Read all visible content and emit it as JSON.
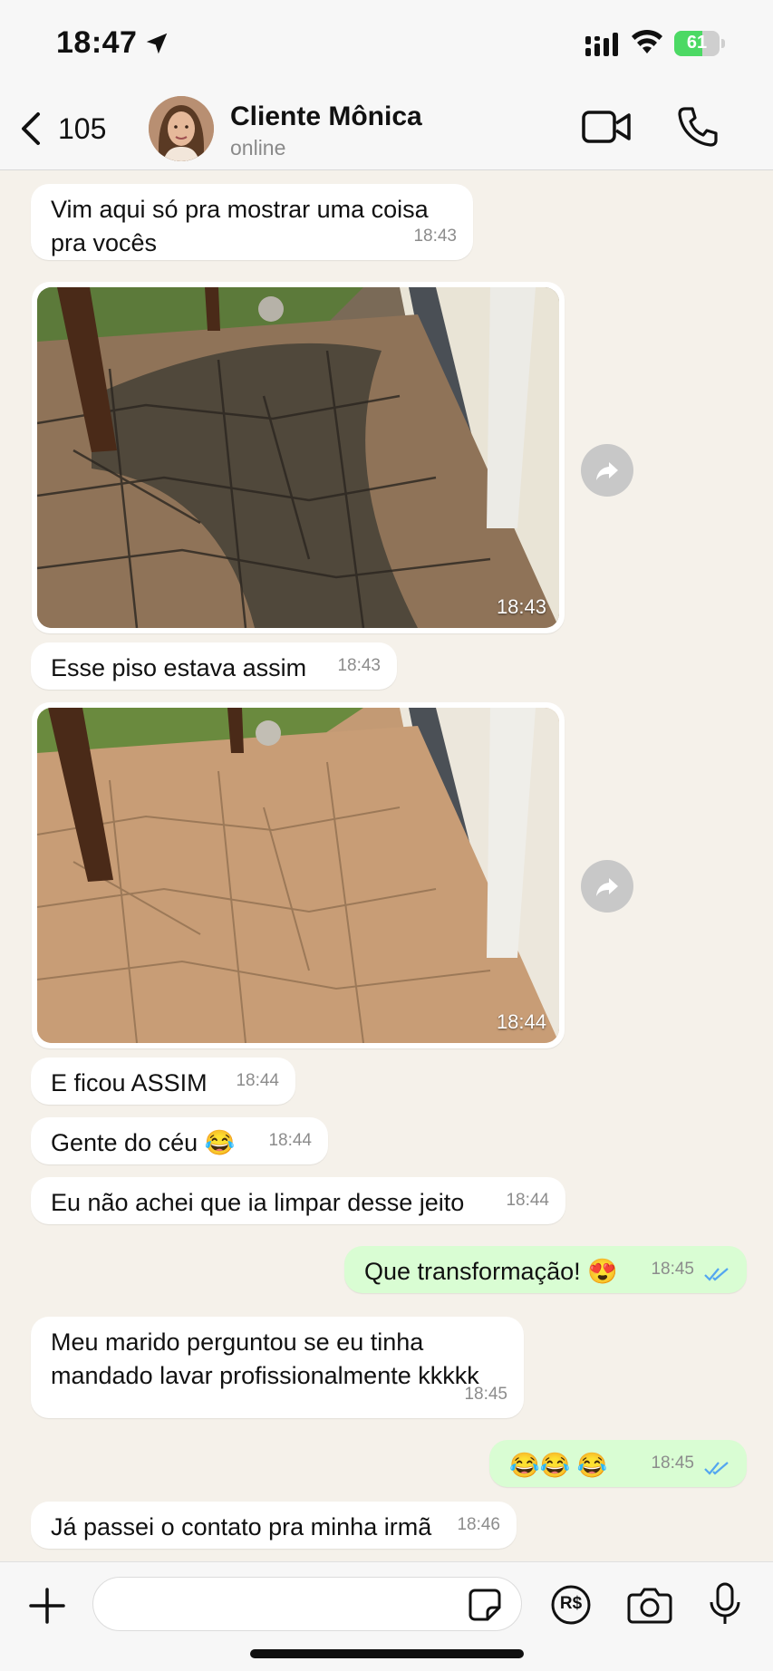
{
  "status_bar": {
    "time": "18:47",
    "battery": "61",
    "battery_level": 0.61
  },
  "header": {
    "back_count": "105",
    "contact_name": "Cliente Mônica",
    "contact_status": "online"
  },
  "messages": [
    {
      "type": "text",
      "direction": "in",
      "text_lines": [
        "Vim aqui só pra mostrar uma coisa",
        "pra vocês"
      ],
      "time": "18:43"
    },
    {
      "type": "image",
      "direction": "in",
      "alt": "Piso de pedra sujo antes da limpeza",
      "time": "18:43"
    },
    {
      "type": "text",
      "direction": "in",
      "text": "Esse piso estava assim",
      "time": "18:43"
    },
    {
      "type": "image",
      "direction": "in",
      "alt": "Piso de pedra limpo depois da limpeza",
      "time": "18:44"
    },
    {
      "type": "text",
      "direction": "in",
      "text": "E ficou ASSIM",
      "time": "18:44"
    },
    {
      "type": "text",
      "direction": "in",
      "text": "Gente do céu 😂",
      "time": "18:44"
    },
    {
      "type": "text",
      "direction": "in",
      "text": "Eu não achei que ia limpar desse jeito",
      "time": "18:44"
    },
    {
      "type": "text",
      "direction": "out",
      "text": "Que transformação! 😍",
      "time": "18:45"
    },
    {
      "type": "text",
      "direction": "in",
      "text_lines": [
        "Meu marido perguntou se eu tinha",
        "mandado lavar profissionalmente kkkkk"
      ],
      "time": "18:45"
    },
    {
      "type": "text",
      "direction": "out",
      "text": "😂😂 😂",
      "time": "18:45"
    },
    {
      "type": "text",
      "direction": "in",
      "text": "Já passei o contato pra minha irmã",
      "time": "18:46"
    }
  ],
  "icons": {
    "back": "chevron-left-icon",
    "video": "video-camera-icon",
    "call": "phone-icon",
    "forward": "forward-arrow-icon",
    "plus": "plus-icon",
    "sticker": "sticker-icon",
    "payment": "payment-rs-icon",
    "camera": "camera-icon",
    "mic": "microphone-icon"
  },
  "composer": {
    "payment_label": "R$"
  },
  "colors": {
    "incoming": "#ffffff",
    "outgoing": "#d9fdd3",
    "read_ticks": "#53a6f0",
    "chat_bg": "#f5f1ea"
  }
}
